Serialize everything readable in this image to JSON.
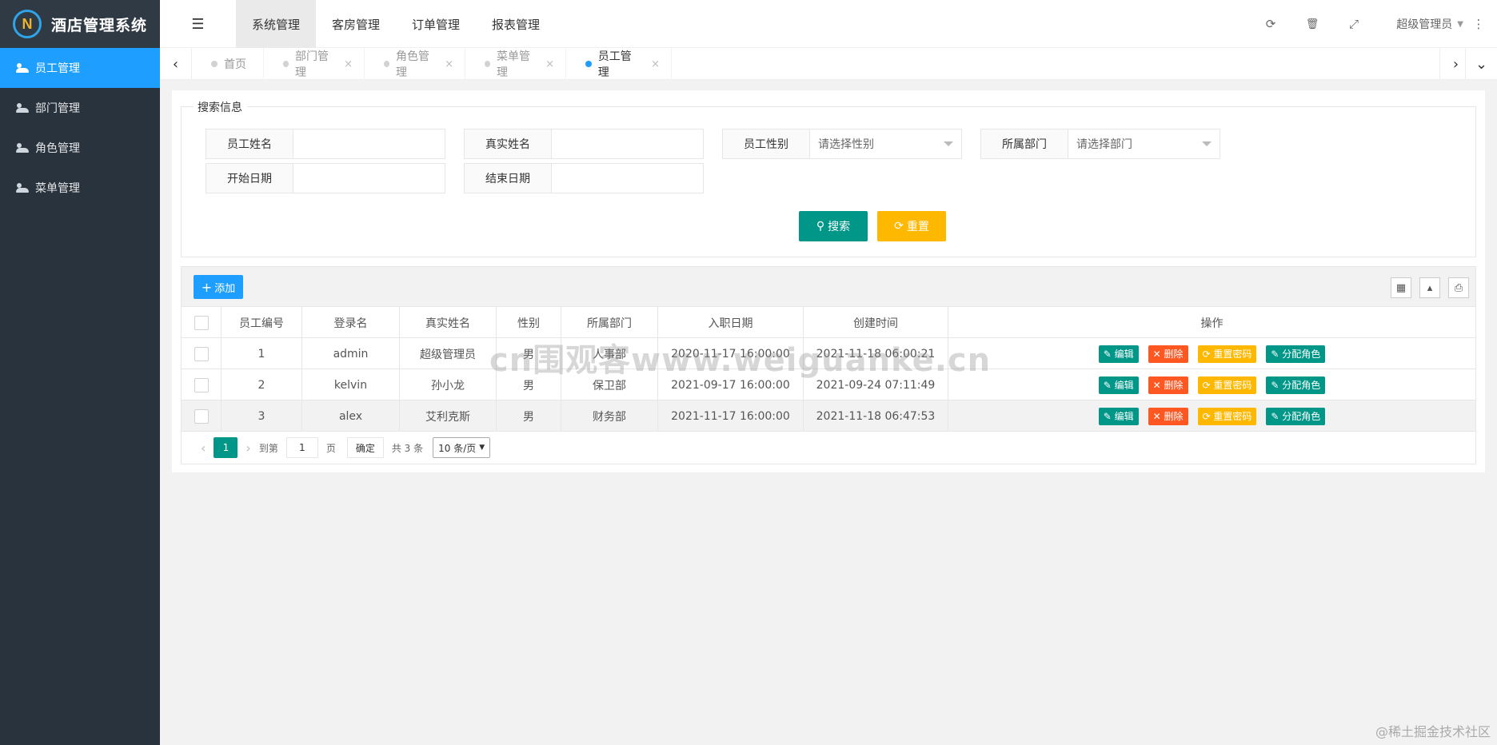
{
  "app": {
    "title": "酒店管理系统",
    "logo_letter": "N"
  },
  "sidebar": {
    "items": [
      {
        "label": "员工管理",
        "active": true
      },
      {
        "label": "部门管理"
      },
      {
        "label": "角色管理"
      },
      {
        "label": "菜单管理"
      }
    ]
  },
  "header": {
    "menu_icon": "☰",
    "tabs": [
      {
        "label": "系统管理",
        "active": true
      },
      {
        "label": "客房管理"
      },
      {
        "label": "订单管理"
      },
      {
        "label": "报表管理"
      }
    ],
    "icons": {
      "refresh": "⟳",
      "trash": "🗑",
      "fullscreen": "⤢",
      "more": "⋮"
    },
    "user": "超级管理员",
    "caret": "▼"
  },
  "page_tabs": {
    "left_arrow": "‹",
    "right_arrow": "›",
    "dropdown_arrow": "⌄",
    "close": "×",
    "items": [
      {
        "label": "首页"
      },
      {
        "label": "部门管理"
      },
      {
        "label": "角色管理"
      },
      {
        "label": "菜单管理"
      },
      {
        "label": "员工管理",
        "active": true
      }
    ]
  },
  "search": {
    "legend": "搜索信息",
    "fields": {
      "emp_name": "员工姓名",
      "real_name": "真实姓名",
      "gender": "员工性别",
      "gender_placeholder": "请选择性别",
      "dept": "所属部门",
      "dept_placeholder": "请选择部门",
      "start_date": "开始日期",
      "end_date": "结束日期"
    },
    "search_btn": "搜索",
    "reset_btn": "重置"
  },
  "table": {
    "add_btn": "添加",
    "columns": [
      "员工编号",
      "登录名",
      "真实姓名",
      "性别",
      "所属部门",
      "入职日期",
      "创建时间",
      "操作"
    ],
    "rows": [
      {
        "id": "1",
        "login": "admin",
        "real": "超级管理员",
        "gender": "男",
        "dept": "人事部",
        "hire": "2020-11-17 16:00:00",
        "created": "2021-11-18 06:00:21"
      },
      {
        "id": "2",
        "login": "kelvin",
        "real": "孙小龙",
        "gender": "男",
        "dept": "保卫部",
        "hire": "2021-09-17 16:00:00",
        "created": "2021-09-24 07:11:49"
      },
      {
        "id": "3",
        "login": "alex",
        "real": "艾利克斯",
        "gender": "男",
        "dept": "财务部",
        "hire": "2021-11-17 16:00:00",
        "created": "2021-11-18 06:47:53"
      }
    ],
    "ops": {
      "edit": "编辑",
      "delete": "删除",
      "reset_pwd": "重置密码",
      "assign_role": "分配角色"
    }
  },
  "pager": {
    "prev": "‹",
    "next": "›",
    "current": "1",
    "goto_label": "到第",
    "goto_value": "1",
    "page_label": "页",
    "confirm": "确定",
    "total": "共 3 条",
    "size": "10 条/页"
  },
  "watermark": "cn围观客www.weiguanke.cn",
  "corner_mark": "@稀土掘金技术社区",
  "colors": {
    "primary": "#009688",
    "blue": "#1e9fff",
    "danger": "#ff5722",
    "warn": "#ffb800",
    "sidebar": "#28333e"
  }
}
